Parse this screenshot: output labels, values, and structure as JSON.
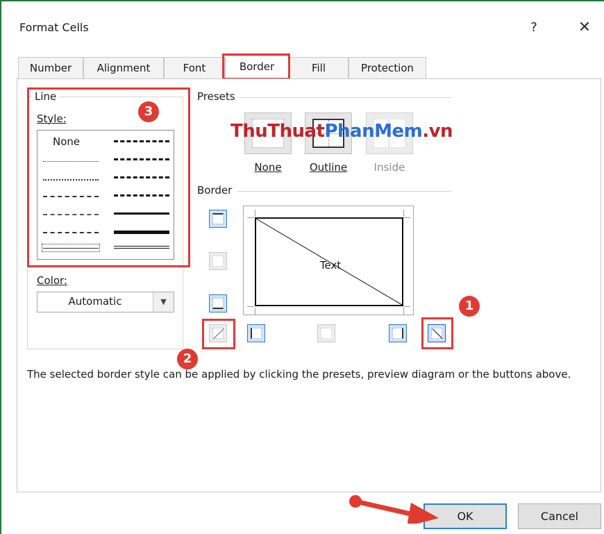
{
  "dialog": {
    "title": "Format Cells",
    "help_glyph": "?",
    "close_glyph": "✕"
  },
  "tabs": [
    {
      "label": "Number"
    },
    {
      "label": "Alignment"
    },
    {
      "label": "Font"
    },
    {
      "label": "Border"
    },
    {
      "label": "Fill"
    },
    {
      "label": "Protection"
    }
  ],
  "active_tab": "Border",
  "line": {
    "group_label": "Line",
    "style_label": "Style:",
    "style_none": "None",
    "color_label": "Color:",
    "color_value": "Automatic"
  },
  "presets": {
    "group_label": "Presets",
    "items": [
      {
        "label": "None"
      },
      {
        "label": "Outline"
      },
      {
        "label": "Inside"
      }
    ]
  },
  "border": {
    "group_label": "Border",
    "preview_text": "Text"
  },
  "help_text": "The selected border style can be applied by clicking the presets, preview diagram or the buttons above.",
  "buttons": {
    "ok": "OK",
    "cancel": "Cancel"
  },
  "annotations": {
    "badges": [
      "1",
      "2",
      "3"
    ],
    "accent_color": "#e03b31"
  },
  "watermark": {
    "part1": "ThuThuat",
    "part2": "PhanMem",
    "part3": ".vn"
  },
  "colors": {
    "selection_blue": "#2e78c7",
    "window_border": "#1f7a3a"
  }
}
